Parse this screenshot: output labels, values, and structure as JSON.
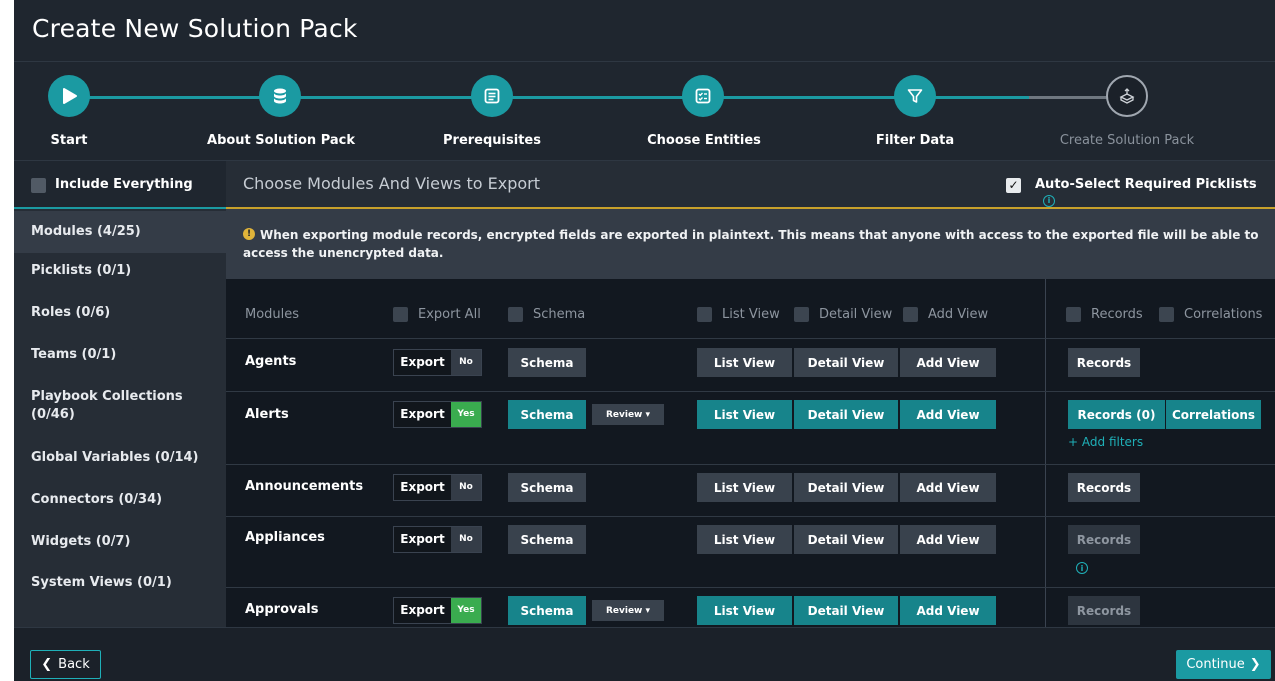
{
  "title": "Create New Solution Pack",
  "colors": {
    "accent": "#1b9aa2",
    "warning": "#e0b43a",
    "yes": "#3aac4f"
  },
  "wizard": {
    "steps": [
      {
        "label": "Start",
        "icon": "play-icon",
        "state": "done"
      },
      {
        "label": "About Solution Pack",
        "icon": "database-icon",
        "state": "done"
      },
      {
        "label": "Prerequisites",
        "icon": "list-icon",
        "state": "done"
      },
      {
        "label": "Choose Entities",
        "icon": "checklist-icon",
        "state": "done"
      },
      {
        "label": "Filter Data",
        "icon": "filter-icon",
        "state": "done"
      },
      {
        "label": "Create Solution Pack",
        "icon": "box-icon",
        "state": "pending"
      }
    ]
  },
  "sidebar": {
    "include_everything": "Include Everything",
    "items": [
      {
        "label": "Modules (4/25)"
      },
      {
        "label": "Picklists (0/1)"
      },
      {
        "label": "Roles (0/6)"
      },
      {
        "label": "Teams (0/1)"
      },
      {
        "label": "Playbook Collections (0/46)"
      },
      {
        "label": "Global Variables (0/14)"
      },
      {
        "label": "Connectors (0/34)"
      },
      {
        "label": "Widgets (0/7)"
      },
      {
        "label": "System Views (0/1)"
      }
    ]
  },
  "main": {
    "heading": "Choose Modules And Views to Export",
    "auto_select_label": "Auto-Select Required Picklists",
    "auto_select_checked": true,
    "warning": "When exporting module records, encrypted fields are exported in plaintext. This means that anyone with access to the exported file will be able to access the unencrypted data.",
    "headers": {
      "modules": "Modules",
      "export_all": "Export All",
      "schema": "Schema",
      "list_view": "List View",
      "detail_view": "Detail View",
      "add_view": "Add View",
      "records": "Records",
      "correlations": "Correlations"
    },
    "rows": [
      {
        "name": "Agents",
        "export": "Export",
        "toggle": "No",
        "schema": "Schema",
        "list_view": "List View",
        "detail_view": "Detail View",
        "add_view": "Add View",
        "records": "Records"
      },
      {
        "name": "Alerts",
        "export": "Export",
        "toggle": "Yes",
        "schema": "Schema",
        "review": "Review",
        "list_view": "List View",
        "detail_view": "Detail View",
        "add_view": "Add View",
        "records": "Records (0)",
        "correlations": "Correlations",
        "add_filters": "Add filters"
      },
      {
        "name": "Announcements",
        "export": "Export",
        "toggle": "No",
        "schema": "Schema",
        "list_view": "List View",
        "detail_view": "Detail View",
        "add_view": "Add View",
        "records": "Records"
      },
      {
        "name": "Appliances",
        "export": "Export",
        "toggle": "No",
        "schema": "Schema",
        "list_view": "List View",
        "detail_view": "Detail View",
        "add_view": "Add View",
        "records": "Records"
      },
      {
        "name": "Approvals",
        "export": "Export",
        "toggle": "Yes",
        "schema": "Schema",
        "review": "Review",
        "list_view": "List View",
        "detail_view": "Detail View",
        "add_view": "Add View",
        "records": "Records"
      }
    ]
  },
  "footer": {
    "back": "Back",
    "continue": "Continue"
  }
}
